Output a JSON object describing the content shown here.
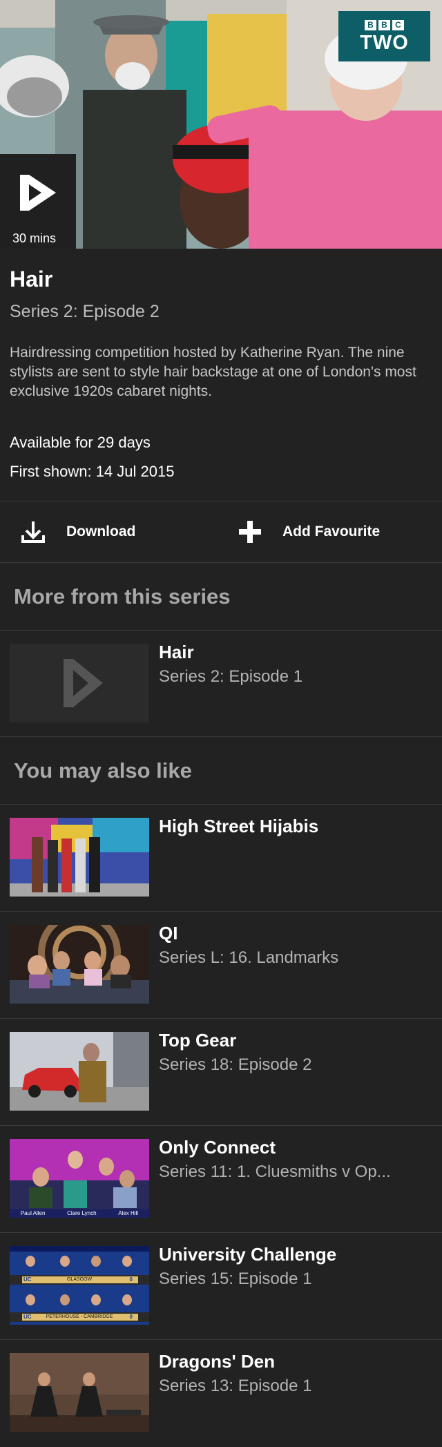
{
  "hero": {
    "channel_logo_top": [
      "B",
      "B",
      "C"
    ],
    "channel_name": "TWO",
    "duration": "30 mins"
  },
  "episode": {
    "title": "Hair",
    "subtitle": "Series 2: Episode 2",
    "description": "Hairdressing competition hosted by Katherine Ryan. The nine stylists are sent to style hair backstage at one of London's most exclusive 1920s cabaret nights.",
    "availability": "Available for 29 days",
    "first_shown": "First shown: 14 Jul 2015"
  },
  "actions": {
    "download_label": "Download",
    "download_icon": "download-icon",
    "favourite_label": "Add Favourite",
    "favourite_icon": "plus-icon"
  },
  "more_from_series": {
    "heading": "More from this series",
    "items": [
      {
        "title": "Hair",
        "subtitle": "Series 2: Episode 1"
      }
    ]
  },
  "also_like": {
    "heading": "You may also like",
    "items": [
      {
        "title": "High Street Hijabis",
        "subtitle": ""
      },
      {
        "title": "QI",
        "subtitle": "Series L: 16. Landmarks"
      },
      {
        "title": "Top Gear",
        "subtitle": "Series 18: Episode 2"
      },
      {
        "title": "Only Connect",
        "subtitle": "Series 11: 1. Cluesmiths v Op..."
      },
      {
        "title": "University Challenge",
        "subtitle": "Series 15: Episode 1"
      },
      {
        "title": "Dragons' Den",
        "subtitle": "Series 13: Episode 1"
      }
    ]
  },
  "thumbnails": {
    "only_connect_names": [
      "Paul Allen",
      "Clare Lynch",
      "Alex Hill"
    ],
    "university_challenge_teams": [
      "GLASGOW",
      "PETERHOUSE - CAMBRIDGE"
    ],
    "university_challenge_badge": "UC",
    "university_challenge_scores": [
      "0",
      "0"
    ]
  },
  "colors": {
    "background": "#222222",
    "channel_badge": "#0d5e66",
    "divider": "#3a3a3a",
    "secondary_text": "#b3b3b3"
  }
}
